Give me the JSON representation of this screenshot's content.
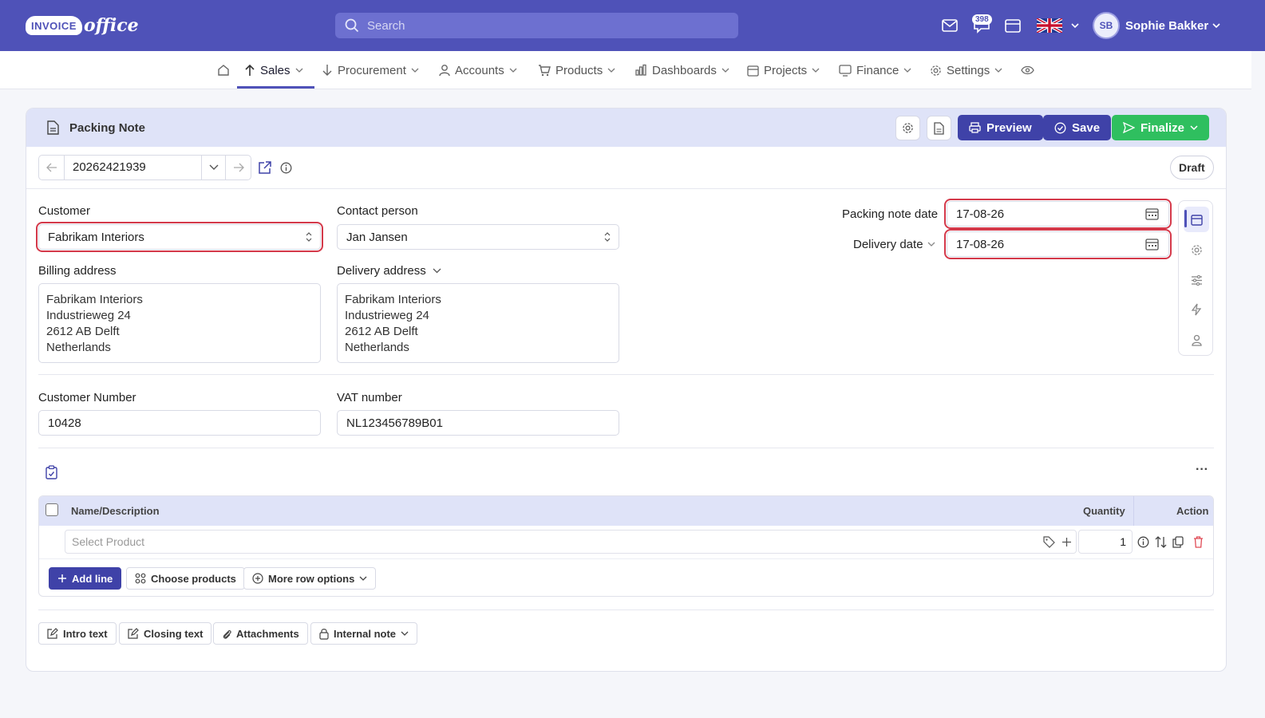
{
  "app": {
    "logo_word1": "INVOICE",
    "logo_word2": "office"
  },
  "search": {
    "placeholder": "Search"
  },
  "topbar": {
    "notifications_count": "398",
    "user_initials": "SB",
    "user_name": "Sophie Bakker"
  },
  "nav": {
    "items": [
      {
        "label": "Sales"
      },
      {
        "label": "Procurement"
      },
      {
        "label": "Accounts"
      },
      {
        "label": "Products"
      },
      {
        "label": "Dashboards"
      },
      {
        "label": "Projects"
      },
      {
        "label": "Finance"
      },
      {
        "label": "Settings"
      }
    ]
  },
  "document": {
    "title": "Packing Note",
    "preview_label": "Preview",
    "save_label": "Save",
    "finalize_label": "Finalize",
    "number": "20262421939",
    "status": "Draft"
  },
  "form": {
    "customer_label": "Customer",
    "customer_value": "Fabrikam Interiors",
    "contact_label": "Contact person",
    "contact_value": "Jan Jansen",
    "packing_date_label": "Packing note date",
    "packing_date_value": "17-08-26",
    "delivery_date_label": "Delivery date",
    "delivery_date_value": "17-08-26",
    "billing_label": "Billing address",
    "billing_lines": [
      "Fabrikam Interiors",
      "Industrieweg 24",
      "2612 AB Delft",
      "Netherlands"
    ],
    "delivery_label": "Delivery address",
    "delivery_lines": [
      "Fabrikam Interiors",
      "Industrieweg 24",
      "2612 AB Delft",
      "Netherlands"
    ],
    "customer_number_label": "Customer Number",
    "customer_number_value": "10428",
    "vat_label": "VAT number",
    "vat_value": "NL123456789B01"
  },
  "lines": {
    "col_name": "Name/Description",
    "col_qty": "Quantity",
    "col_action": "Action",
    "product_placeholder": "Select Product",
    "qty_value": "1",
    "add_line": "Add line",
    "choose_products": "Choose products",
    "more_row_options": "More row options",
    "more_menu": "···"
  },
  "footer_buttons": {
    "intro": "Intro text",
    "closing": "Closing text",
    "attachments": "Attachments",
    "internal_note": "Internal note"
  },
  "colors": {
    "primary": "#4f52b8",
    "button_dark": "#3f42a8",
    "finalize": "#2fbf5f",
    "highlight": "#d4394a",
    "header_tint": "#dfe3f8"
  }
}
